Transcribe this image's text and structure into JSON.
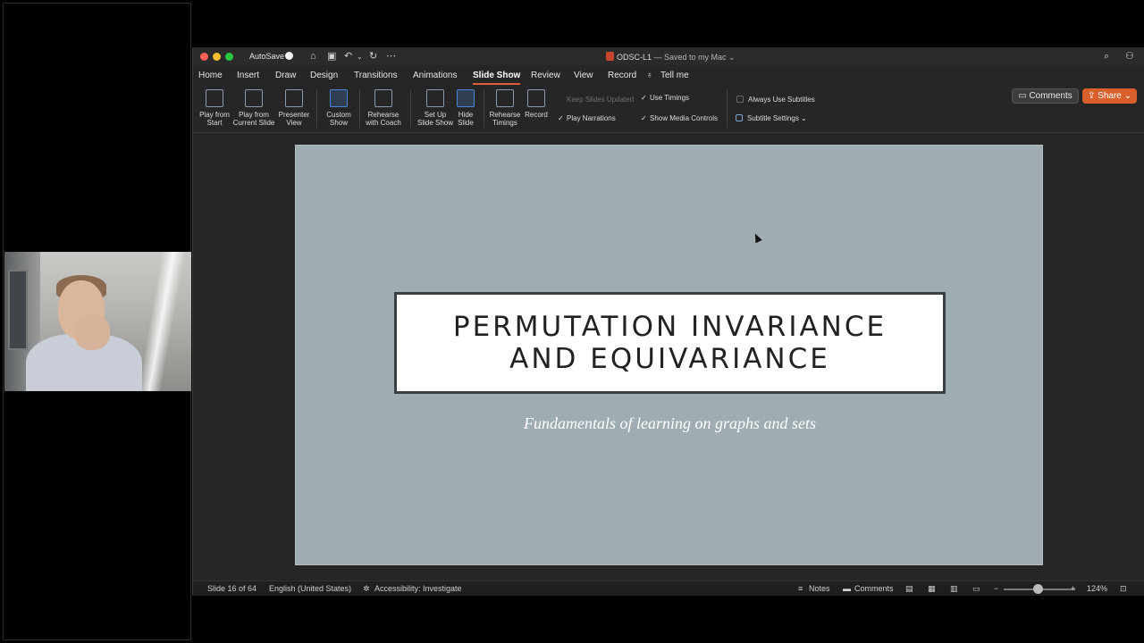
{
  "titlebar": {
    "autosave_label": "AutoSave",
    "doc_name": "ODSC-L1",
    "doc_status": " — Saved to my Mac ⌄"
  },
  "menu": {
    "tabs": [
      "Home",
      "Insert",
      "Draw",
      "Design",
      "Transitions",
      "Animations",
      "Slide Show",
      "Review",
      "View",
      "Record",
      "Tell me"
    ],
    "active": "Slide Show",
    "comments": "Comments",
    "share": "Share"
  },
  "ribbon": {
    "buttons": [
      {
        "l1": "Play from",
        "l2": "Start"
      },
      {
        "l1": "Play from",
        "l2": "Current Slide"
      },
      {
        "l1": "Presenter",
        "l2": "View"
      },
      {
        "l1": "Custom",
        "l2": "Show"
      },
      {
        "l1": "Rehearse",
        "l2": "with Coach"
      },
      {
        "l1": "Set Up",
        "l2": "Slide Show"
      },
      {
        "l1": "Hide",
        "l2": "Slide"
      },
      {
        "l1": "Rehearse",
        "l2": "Timings"
      },
      {
        "l1": "Record",
        "l2": ""
      }
    ],
    "keep_slides_updated": "Keep Slides Updated",
    "play_narrations": "Play Narrations",
    "use_timings": "Use Timings",
    "show_media_controls": "Show Media Controls",
    "always_use_subtitles": "Always Use Subtitles",
    "subtitle_settings": "Subtitle Settings"
  },
  "slide": {
    "title_line1": "PERMUTATION INVARIANCE",
    "title_line2": "AND EQUIVARIANCE",
    "subtitle": "Fundamentals of learning on graphs and sets"
  },
  "statusbar": {
    "slide_count": "Slide 16 of 64",
    "language": "English (United States)",
    "accessibility": "Accessibility: Investigate",
    "notes": "Notes",
    "comments": "Comments",
    "zoom": "124%"
  },
  "colors": {
    "accent": "#e05b3a",
    "share": "#d9602c",
    "slide_bg": "#9fadb3"
  }
}
